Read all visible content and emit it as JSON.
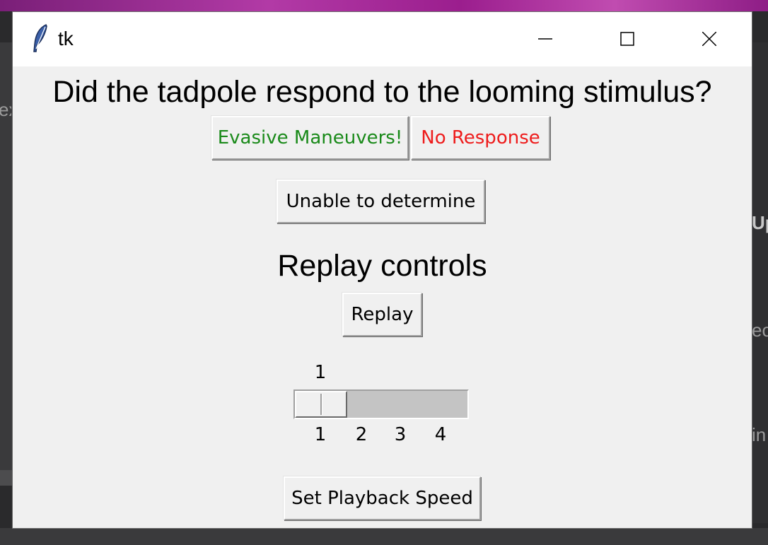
{
  "window": {
    "title": "tk",
    "icon": "tk-feather-icon",
    "controls": [
      "minimize-icon",
      "maximize-icon",
      "close-icon"
    ]
  },
  "question": "Did the tadpole respond to the looming stimulus?",
  "buttons": {
    "evasive": "Evasive Maneuvers!",
    "no_response": "No Response",
    "unable": "Unable to determine",
    "replay": "Replay",
    "set_speed": "Set Playback Speed"
  },
  "replay_heading": "Replay controls",
  "speed_scale": {
    "value": "1",
    "ticks": [
      "1",
      "2",
      "3",
      "4"
    ],
    "min": 1,
    "max": 4
  },
  "background": {
    "left_text": "ex",
    "right_texts": [
      "Up",
      "ec",
      "in"
    ]
  },
  "colors": {
    "evasive_text": "#1a8a1a",
    "no_response_text": "#ee1c1c",
    "window_bg": "#f0f0f0",
    "titlebar_bg": "#ffffff"
  }
}
